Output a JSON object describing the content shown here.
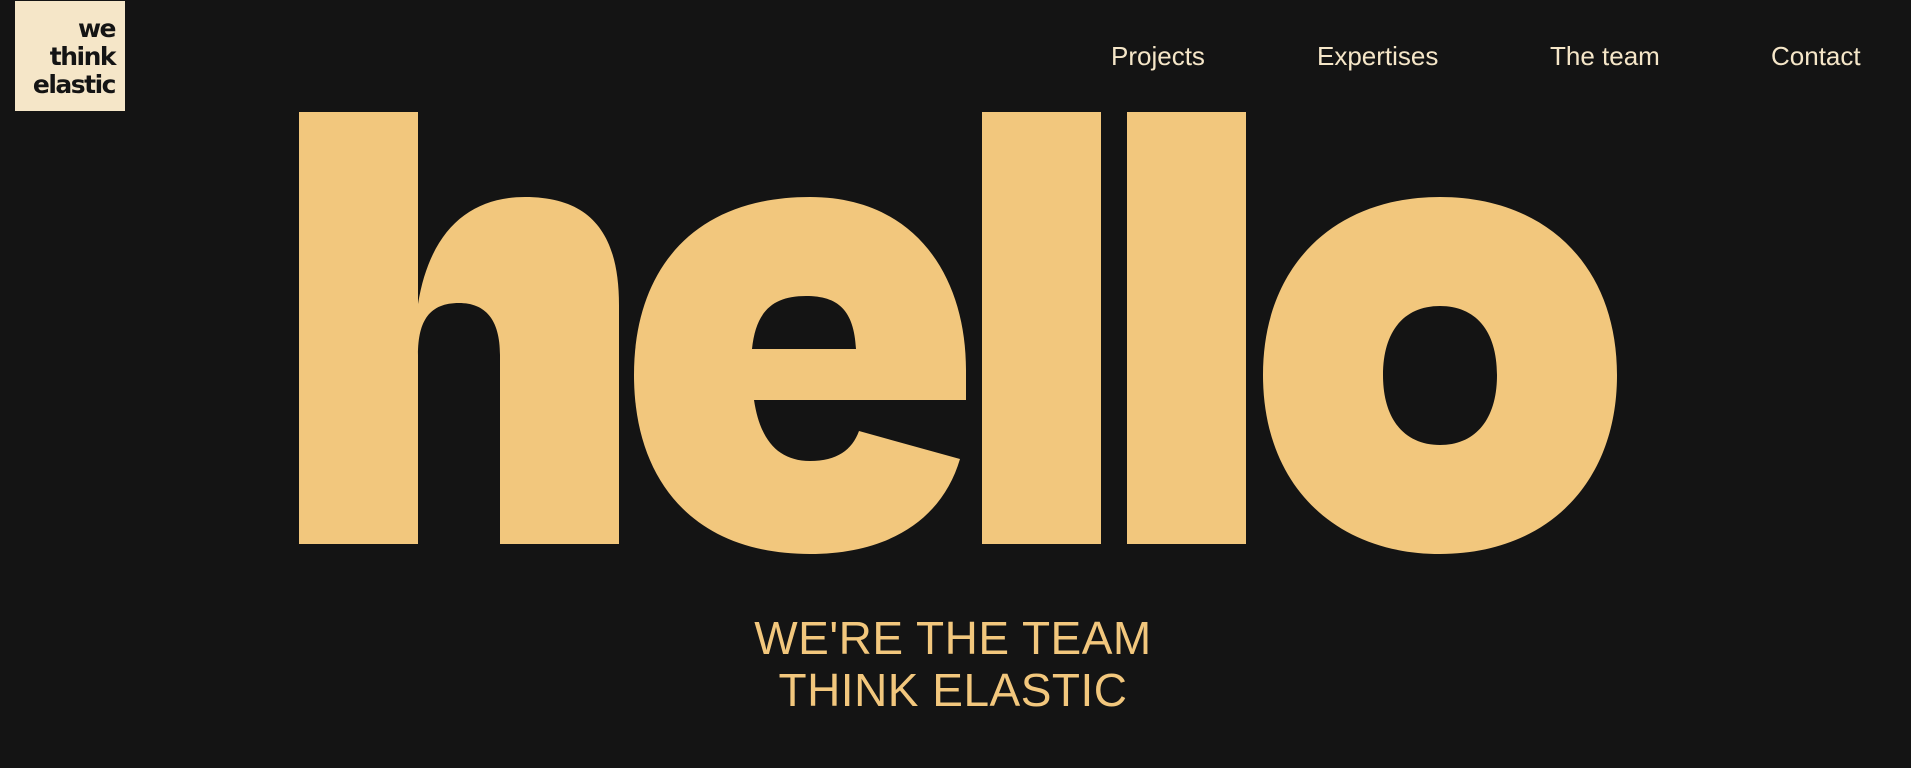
{
  "brand": {
    "logo_lines": [
      "we",
      "think",
      "elastic"
    ]
  },
  "nav": {
    "items": [
      "Projects",
      "Expertises",
      "The team",
      "Contact"
    ]
  },
  "hero": {
    "headline": "hello"
  },
  "tagline": {
    "line1": "WE'RE THE TEAM",
    "line2": "THINK ELASTIC"
  },
  "colors": {
    "background": "#141414",
    "accent": "#f2c77d",
    "logo_bg": "#f5e6c8",
    "nav_text": "#f5e6c8"
  }
}
